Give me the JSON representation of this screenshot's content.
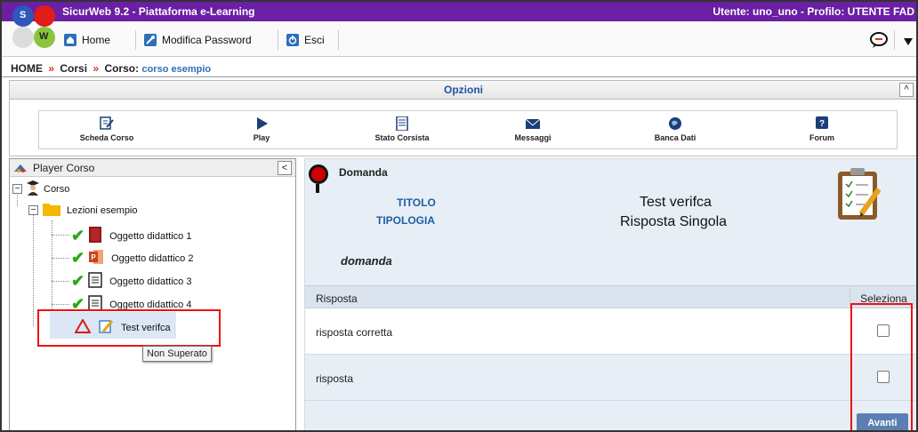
{
  "app": {
    "title": "SicurWeb 9.2 - Piattaforma e-Learning",
    "user_info": "Utente: uno_uno - Profilo: UTENTE FAD",
    "logo_letters": [
      "S",
      "W"
    ]
  },
  "menu": {
    "home": "Home",
    "password": "Modifica Password",
    "exit": "Esci"
  },
  "breadcrumb": {
    "home": "HOME",
    "corsi": "Corsi",
    "corso_label": "Corso:",
    "corso_name": "corso esempio",
    "separator": "»"
  },
  "opzioni": {
    "title": "Opzioni",
    "collapse_glyph": "^",
    "tools": [
      {
        "label": "Scheda Corso",
        "icon": "edit-icon"
      },
      {
        "label": "Play",
        "icon": "play-icon"
      },
      {
        "label": "Stato Corsista",
        "icon": "document-icon"
      },
      {
        "label": "Messaggi",
        "icon": "envelope-icon"
      },
      {
        "label": "Banca Dati",
        "icon": "globe-icon"
      },
      {
        "label": "Forum",
        "icon": "help-icon"
      }
    ]
  },
  "player": {
    "title": "Player Corso",
    "collapse_glyph": "<",
    "tree": {
      "root": "Corso",
      "folder": "Lezioni esempio",
      "items": [
        "Oggetto didattico 1",
        "Oggetto didattico 2",
        "Oggetto didattico 3",
        "Oggetto didattico 4"
      ],
      "test": "Test verifca"
    },
    "tooltip": "Non Superato"
  },
  "question": {
    "header": "Domanda",
    "titolo_key": "TITOLO",
    "titolo_val": "Test verifca",
    "tipologia_key": "TIPOLOGIA",
    "tipologia_val": "Risposta Singola",
    "text": "domanda",
    "col_answer": "Risposta",
    "col_select": "Seleziona",
    "answers": [
      "risposta corretta",
      "risposta"
    ],
    "next_button": "Avanti"
  },
  "colors": {
    "titlebar": "#6b1fa3",
    "link_blue": "#1f53a8",
    "check_green": "#29a814",
    "highlight_red": "#e11"
  }
}
